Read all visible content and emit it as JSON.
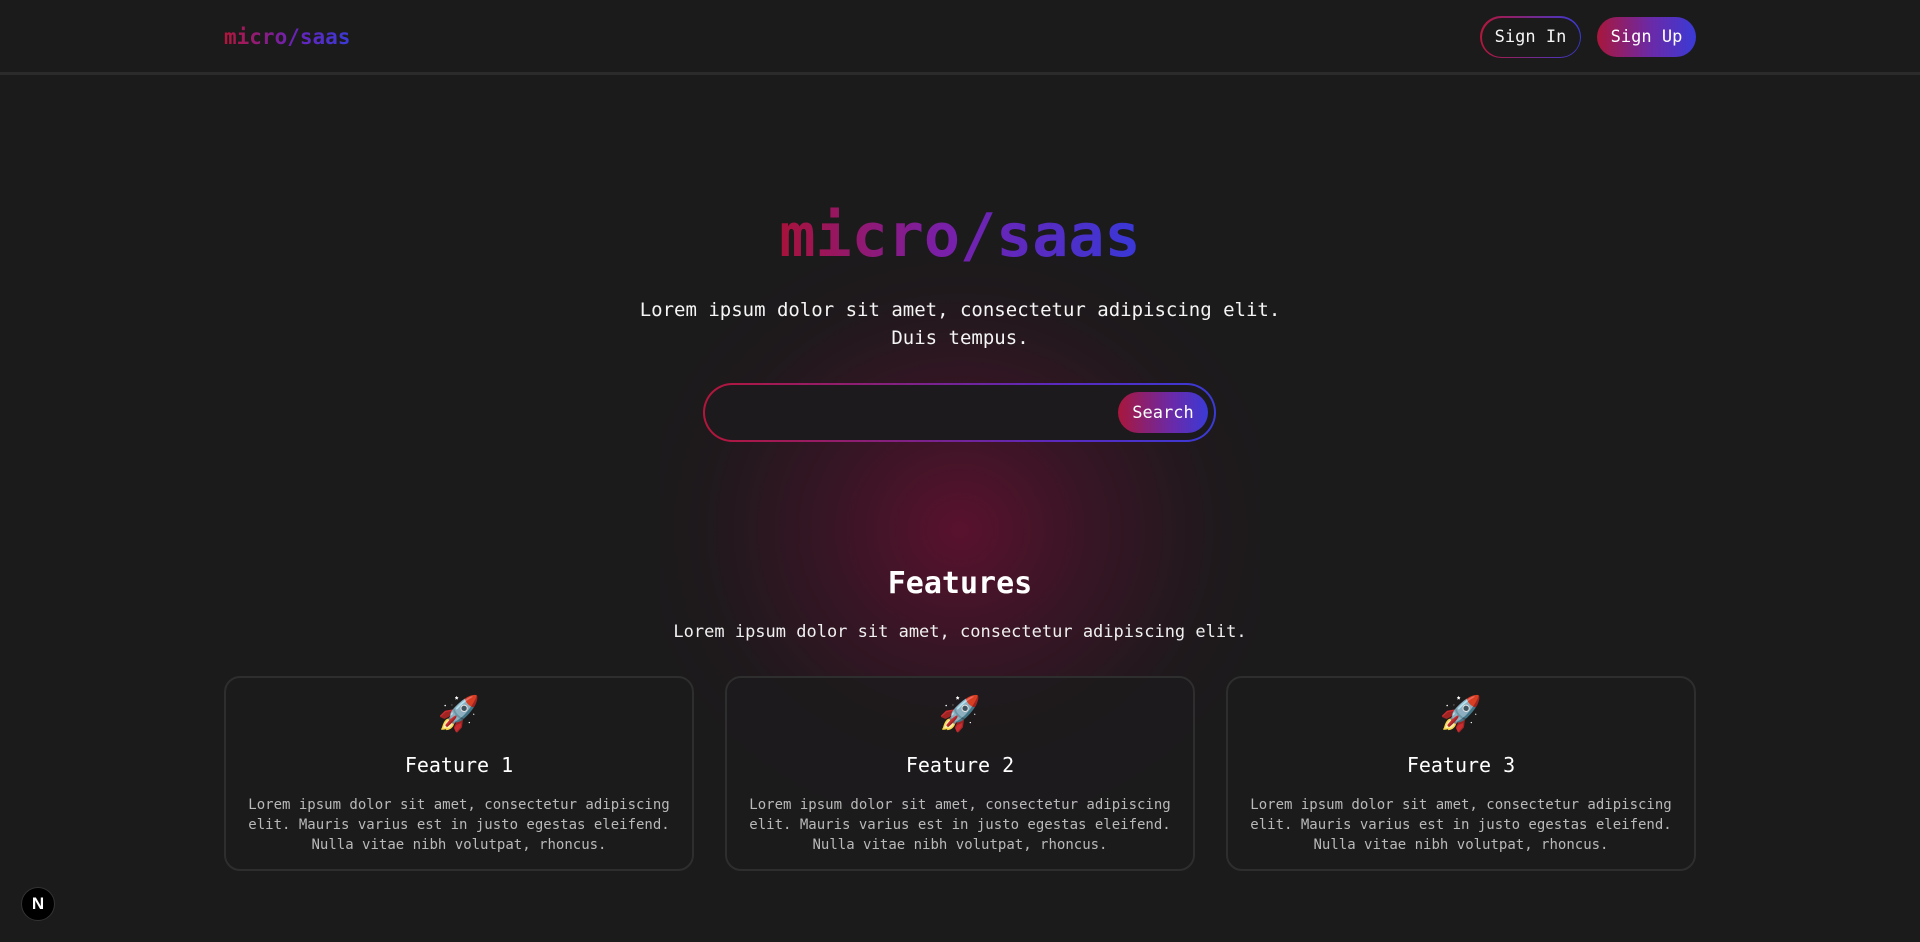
{
  "header": {
    "logo": "micro/saas",
    "sign_in_label": "Sign In",
    "sign_up_label": "Sign Up"
  },
  "hero": {
    "title": "micro/saas",
    "subtitle": "Lorem ipsum dolor sit amet, consectetur adipiscing elit. Duis tempus.",
    "search": {
      "value": "",
      "placeholder": "",
      "button_label": "Search"
    }
  },
  "features": {
    "title": "Features",
    "subtitle": "Lorem ipsum dolor sit amet, consectetur adipiscing elit.",
    "items": [
      {
        "icon": "🚀",
        "icon_name": "rocket-icon",
        "title": "Feature 1",
        "description": "Lorem ipsum dolor sit amet, consectetur adipiscing elit. Mauris varius est in justo egestas eleifend. Nulla vitae nibh volutpat, rhoncus."
      },
      {
        "icon": "🚀",
        "icon_name": "rocket-icon",
        "title": "Feature 2",
        "description": "Lorem ipsum dolor sit amet, consectetur adipiscing elit. Mauris varius est in justo egestas eleifend. Nulla vitae nibh volutpat, rhoncus."
      },
      {
        "icon": "🚀",
        "icon_name": "rocket-icon",
        "title": "Feature 3",
        "description": "Lorem ipsum dolor sit amet, consectetur adipiscing elit. Mauris varius est in justo egestas eleifend. Nulla vitae nibh volutpat, rhoncus."
      }
    ]
  },
  "badge": {
    "letter": "N",
    "icon_name": "nextjs-icon"
  },
  "colors": {
    "background": "#1b1b1b",
    "gradient_start": "#b4163a",
    "gradient_mid": "#6b22b8",
    "gradient_end": "#3a3ad6"
  }
}
